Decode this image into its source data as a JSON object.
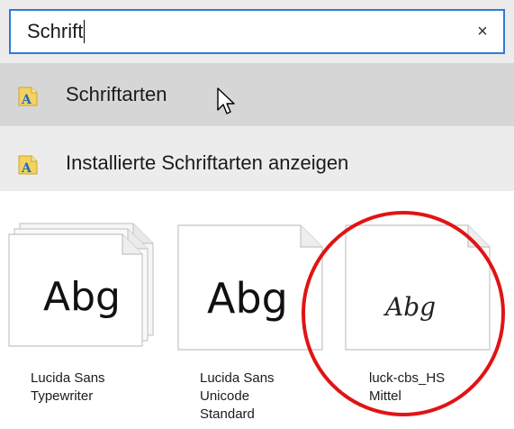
{
  "search": {
    "value": "Schrift",
    "clear_glyph": "×"
  },
  "results": [
    {
      "label": "Schriftarten",
      "icon": "font-folder-icon",
      "selected": true
    },
    {
      "label": "Installierte Schriftarten anzeigen",
      "icon": "font-folder-icon",
      "selected": false
    }
  ],
  "font_tiles": [
    {
      "preview": "Abg",
      "name": "Lucida Sans\nTypewriter",
      "stacked": true
    },
    {
      "preview": "Abg",
      "name": "Lucida Sans\nUnicode\nStandard",
      "stacked": false
    },
    {
      "preview": "Abg",
      "name": "luck-cbs_HS\nMittel",
      "stacked": false,
      "handwritten": true,
      "highlighted": true
    }
  ],
  "colors": {
    "search_border": "#2f7bd8",
    "selected_row": "#d6d6d6",
    "panel_background": "#ececec",
    "highlight_circle": "#e01414"
  }
}
